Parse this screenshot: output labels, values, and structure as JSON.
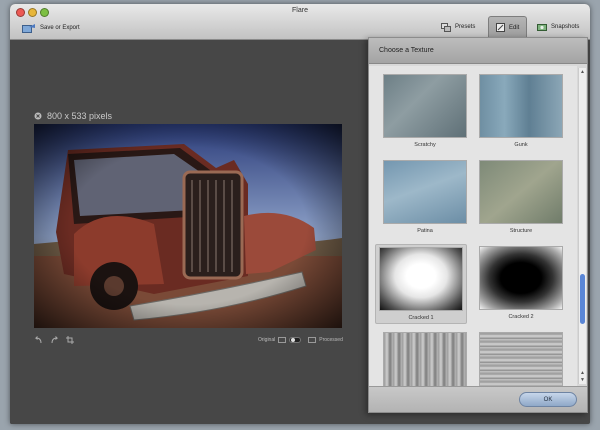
{
  "window": {
    "title": "Flare"
  },
  "toolbar": {
    "save_label": "Save or Export",
    "tabs": [
      {
        "label": "Presets",
        "icon": "presets-icon"
      },
      {
        "label": "Edit",
        "icon": "edit-icon"
      },
      {
        "label": "Snapshots",
        "icon": "snapshots-icon"
      }
    ]
  },
  "image": {
    "size_label": "800 x 533 pixels"
  },
  "compare": {
    "original_label": "Original",
    "processed_label": "Processed"
  },
  "texture_panel": {
    "title": "Choose a Texture",
    "items": [
      {
        "label": "Scratchy"
      },
      {
        "label": "Gunk"
      },
      {
        "label": "Patina"
      },
      {
        "label": "Structure"
      },
      {
        "label": "Cracked 1"
      },
      {
        "label": "Cracked 2"
      },
      {
        "label": ""
      },
      {
        "label": ""
      }
    ],
    "selected_label": "Cracked 1",
    "ok_label": "OK"
  }
}
